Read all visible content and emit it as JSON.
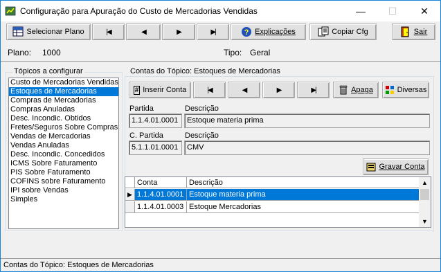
{
  "window": {
    "title": "Configuração para Apuração do Custo de Mercadorias Vendidas",
    "minimize": "—",
    "maximize": "☐",
    "close": "✕"
  },
  "toolbar": {
    "select_plan": "Selecionar Plano",
    "explanations": "Explicações",
    "copy_cfg": "Copiar Cfg",
    "exit": "Sair"
  },
  "info": {
    "plano_label": "Plano:",
    "plano_value": "1000",
    "tipo_label": "Tipo:",
    "tipo_value": "Geral"
  },
  "topics": {
    "title": "Tópicos a configurar",
    "selected_index": 1,
    "items": [
      "Custo de Mercadorias Vendidas",
      "Estoques de Mercadorias",
      "Compras de Mercadorias",
      "Compras Anuladas",
      "Desc. Incondic. Obtidos",
      "Fretes/Seguros Sobre Compras",
      "Vendas de Mercadorias",
      "Vendas Anuladas",
      "Desc. Incondic. Concedidos",
      "ICMS Sobre Faturamento",
      "PIS Sobre Faturamento",
      "COFINS sobre Faturamento",
      "IPI sobre Vendas",
      "Simples"
    ]
  },
  "accounts": {
    "title": "Contas do Tópico: Estoques de Mercadorias",
    "insert_label": "Inserir Conta",
    "delete_label": "Apaga",
    "misc_label": "Diversas",
    "save_label": "Gravar Conta",
    "partida_label": "Partida",
    "partida_value": "1.1.4.01.0001",
    "partida_desc_label": "Descrição",
    "partida_desc_value": "Estoque materia prima",
    "cpartida_label": "C. Partida",
    "cpartida_value": "5.1.1.01.0001",
    "cpartida_desc_label": "Descrição",
    "cpartida_desc_value": "CMV"
  },
  "grid": {
    "columns": [
      "Conta",
      "Descrição"
    ],
    "rows": [
      {
        "conta": "1.1.4.01.0001",
        "descricao": "Estoque materia prima"
      },
      {
        "conta": "1.1.4.01.0003",
        "descricao": "Estoque Mercadorias"
      }
    ],
    "selected_row": 0
  },
  "status": {
    "text": "Contas do Tópico: Estoques de Mercadorias"
  },
  "colors": {
    "selection": "#0078d7",
    "window_border": "#1883d7",
    "face": "#f0f0f0"
  }
}
